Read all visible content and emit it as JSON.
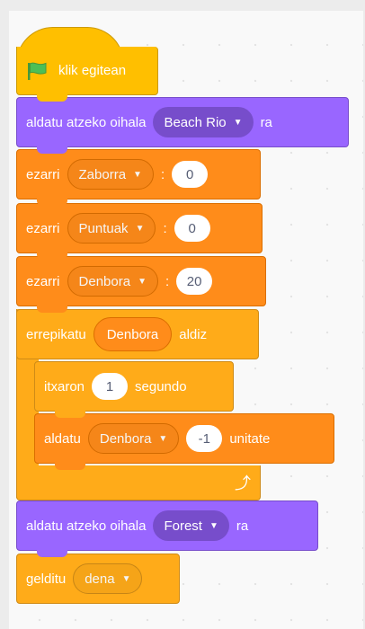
{
  "event": {
    "label": "klik egitean"
  },
  "backdrop1": {
    "label": "aldatu atzeko oihala",
    "value": "Beach Rio",
    "suffix": "ra"
  },
  "set1": {
    "label": "ezarri",
    "var": "Zaborra",
    "sep": ":",
    "value": "0"
  },
  "set2": {
    "label": "ezarri",
    "var": "Puntuak",
    "sep": ":",
    "value": "0"
  },
  "set3": {
    "label": "ezarri",
    "var": "Denbora",
    "sep": ":",
    "value": "20"
  },
  "repeat": {
    "label": "errepikatu",
    "var": "Denbora",
    "suffix": "aldiz"
  },
  "wait": {
    "label": "itxaron",
    "value": "1",
    "suffix": "segundo"
  },
  "change": {
    "label": "aldatu",
    "var": "Denbora",
    "value": "-1",
    "suffix": "unitate"
  },
  "backdrop2": {
    "label": "aldatu atzeko oihala",
    "value": "Forest",
    "suffix": "ra"
  },
  "stop": {
    "label": "gelditu",
    "value": "dena"
  },
  "colors": {
    "event": "#ffbf00",
    "looks": "#9966ff",
    "variables": "#ff8c1a",
    "control": "#ffab19"
  }
}
